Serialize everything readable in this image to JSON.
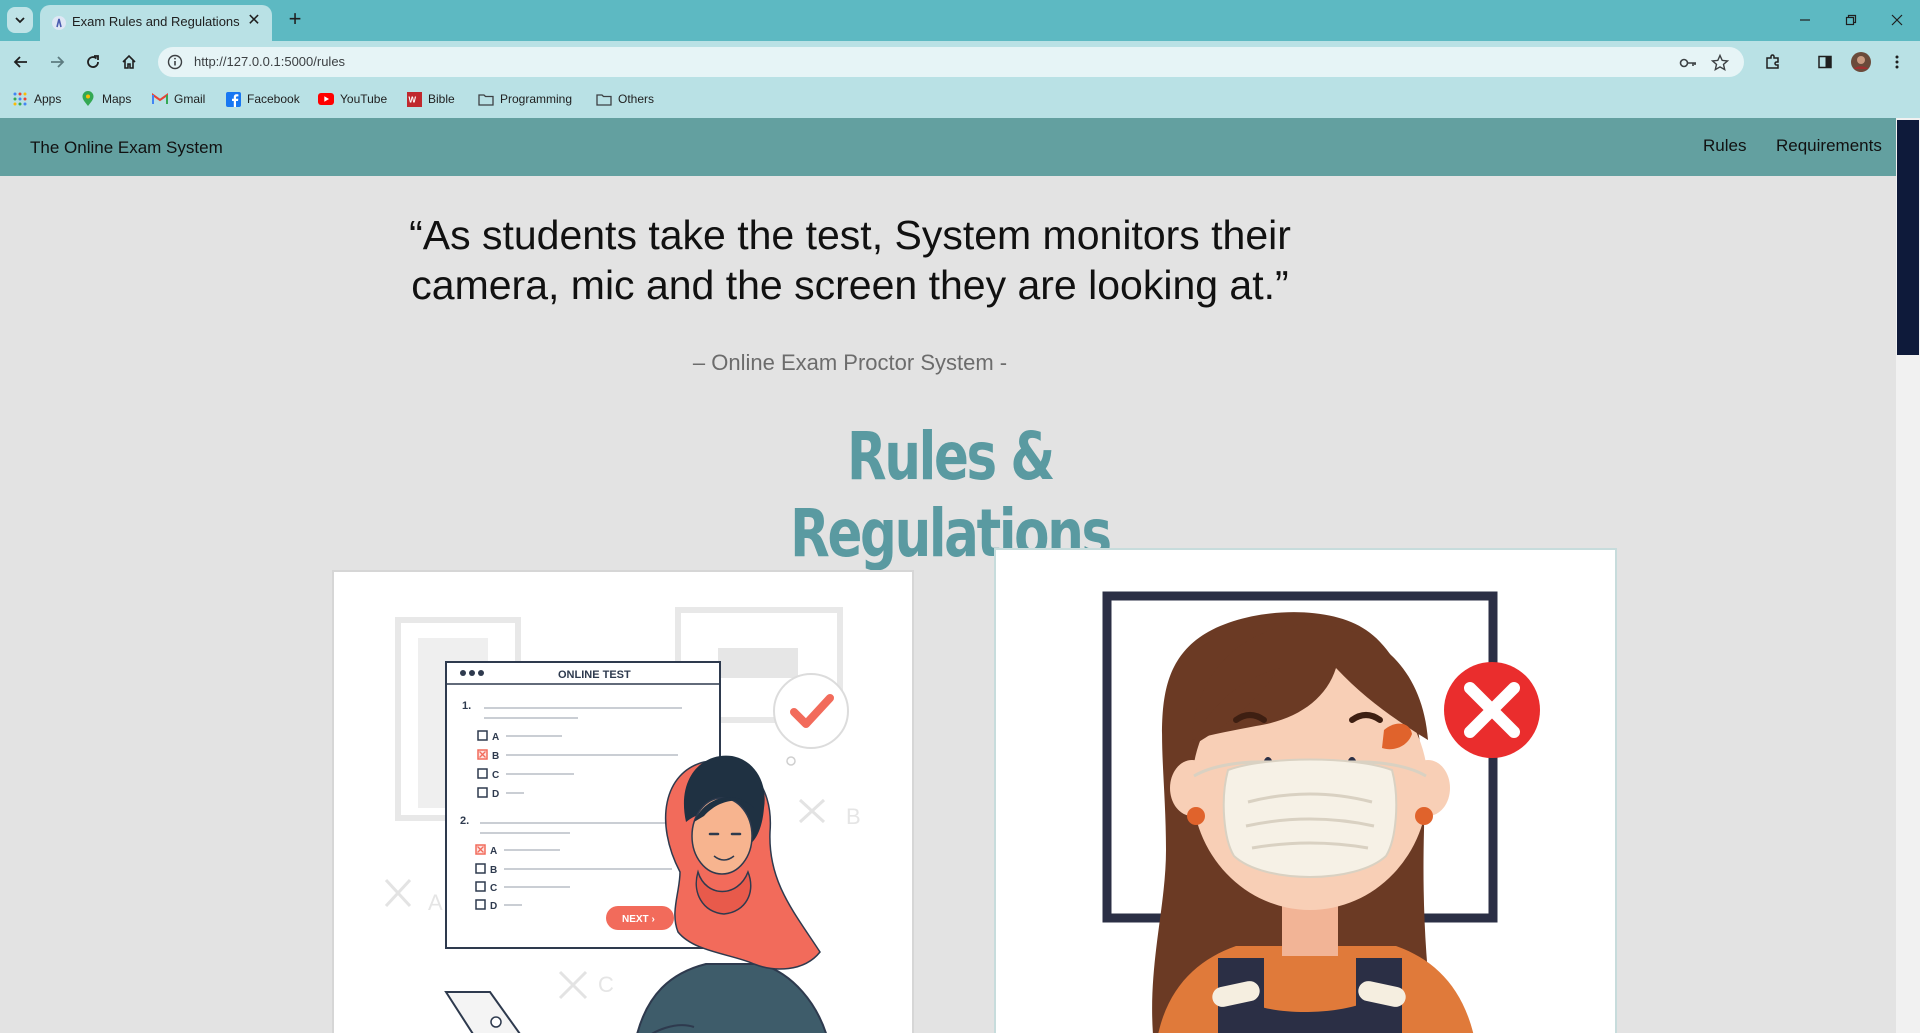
{
  "browser": {
    "tab_title": "Exam Rules and Regulations",
    "url": "http://127.0.0.1:5000/rules",
    "bookmarks": [
      "Apps",
      "Maps",
      "Gmail",
      "Facebook",
      "YouTube",
      "Bible",
      "Programming",
      "Others"
    ]
  },
  "site": {
    "brand": "The Online Exam System",
    "nav": [
      "Rules",
      "Requirements"
    ]
  },
  "hero": {
    "quote_line1": "“As students take the test, System monitors their",
    "quote_line2": "camera, mic and the screen they are looking at.”",
    "attribution": "– Online Exam Proctor System -"
  },
  "rules": {
    "heading": "Rules & Regulations"
  },
  "illustration_online_test": {
    "title": "ONLINE TEST",
    "q1_number": "1.",
    "q2_number": "2.",
    "options": [
      "A",
      "B",
      "C",
      "D"
    ],
    "next_label": "NEXT ›",
    "faded_letters": [
      "A",
      "B",
      "C"
    ],
    "colors": {
      "accent": "#f26b5b",
      "outline": "#2e3a4e"
    }
  },
  "colors": {
    "tabstrip": "#5db9c2",
    "toolbar": "#b9e1e5",
    "navbar": "#63a0a0",
    "heading": "#5a9aa1",
    "page_bg": "#e3e3e3"
  }
}
